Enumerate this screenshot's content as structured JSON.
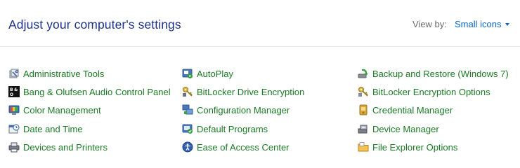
{
  "header": {
    "title": "Adjust your computer's settings",
    "view_by_label": "View by:",
    "view_by_value": "Small icons"
  },
  "items": [
    {
      "label": "Administrative Tools",
      "icon": "administrative-tools-icon"
    },
    {
      "label": "AutoPlay",
      "icon": "autoplay-icon"
    },
    {
      "label": "Backup and Restore (Windows 7)",
      "icon": "backup-restore-icon"
    },
    {
      "label": "Bang & Olufsen Audio Control Panel",
      "icon": "bang-olufsen-icon"
    },
    {
      "label": "BitLocker Drive Encryption",
      "icon": "bitlocker-icon"
    },
    {
      "label": "BitLocker Encryption Options",
      "icon": "bitlocker-options-icon"
    },
    {
      "label": "Color Management",
      "icon": "color-management-icon"
    },
    {
      "label": "Configuration Manager",
      "icon": "configuration-manager-icon"
    },
    {
      "label": "Credential Manager",
      "icon": "credential-manager-icon"
    },
    {
      "label": "Date and Time",
      "icon": "date-time-icon"
    },
    {
      "label": "Default Programs",
      "icon": "default-programs-icon"
    },
    {
      "label": "Device Manager",
      "icon": "device-manager-icon"
    },
    {
      "label": "Devices and Printers",
      "icon": "devices-printers-icon"
    },
    {
      "label": "Ease of Access Center",
      "icon": "ease-of-access-icon"
    },
    {
      "label": "File Explorer Options",
      "icon": "file-explorer-options-icon"
    }
  ],
  "colors": {
    "title": "#1e3287",
    "link": "#1a7a24",
    "accent": "#0a68c8",
    "divider": "#e4e8ee"
  }
}
